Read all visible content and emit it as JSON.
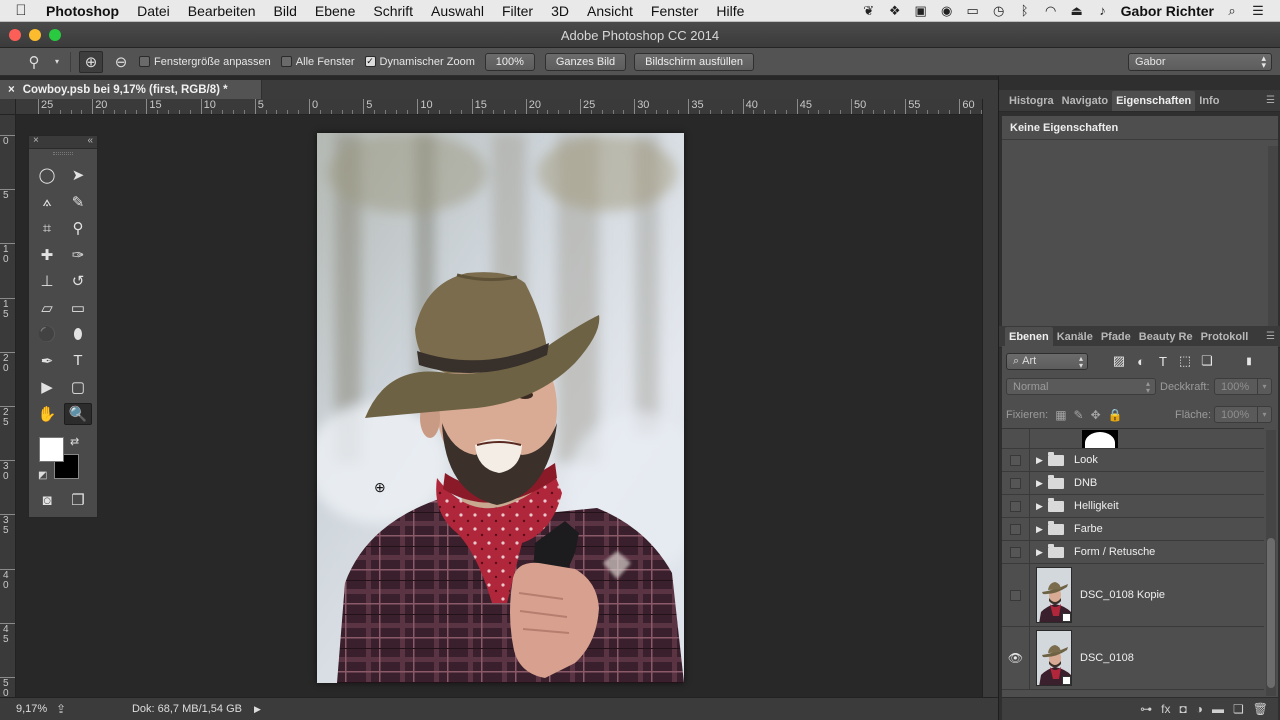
{
  "menubar": {
    "app": "Photoshop",
    "menus": [
      "Datei",
      "Bearbeiten",
      "Bild",
      "Ebene",
      "Schrift",
      "Auswahl",
      "Filter",
      "3D",
      "Ansicht",
      "Fenster",
      "Hilfe"
    ],
    "tray_icons": [
      "evernote-icon",
      "dropbox-icon",
      "app-icon",
      "chrome-icon",
      "airplay-icon",
      "time-machine-icon",
      "bluetooth-icon",
      "wifi-icon",
      "eject-icon",
      "volume-icon"
    ],
    "user": "Gabor Richter",
    "tray_right_icons": [
      "spotlight-icon",
      "notification-center-icon"
    ]
  },
  "window": {
    "title": "Adobe Photoshop CC 2014",
    "lights": [
      "#fc5f57",
      "#fdbc2e",
      "#29c940"
    ]
  },
  "options": {
    "checks": [
      {
        "label": "Fenstergröße anpassen",
        "checked": false
      },
      {
        "label": "Alle Fenster",
        "checked": false
      },
      {
        "label": "Dynamischer Zoom",
        "checked": true
      }
    ],
    "zoom_btn": "100%",
    "fit_btn": "Ganzes Bild",
    "fill_btn": "Bildschirm ausfüllen",
    "workspace": "Gabor"
  },
  "document": {
    "tab": "Cowboy.psb bei 9,17% (first, RGB/8) *",
    "close": "×"
  },
  "ruler": {
    "h_labels": [
      "25",
      "20",
      "15",
      "10",
      "5",
      "0",
      "5",
      "10",
      "15",
      "20",
      "25",
      "30",
      "35",
      "40",
      "45",
      "50",
      "55",
      "60"
    ],
    "v_labels": [
      "0",
      "5",
      "10",
      "15",
      "20",
      "25",
      "30",
      "35",
      "40",
      "45",
      "50"
    ]
  },
  "tools_panel": {
    "close": "×",
    "collapse": "«",
    "tools": [
      {
        "name": "elliptical-marquee-tool",
        "glyph": "◯"
      },
      {
        "name": "move-tool",
        "glyph": "➤"
      },
      {
        "name": "polygonal-lasso-tool",
        "glyph": "⟑"
      },
      {
        "name": "quick-selection-tool",
        "glyph": "✎"
      },
      {
        "name": "crop-tool",
        "glyph": "⌗"
      },
      {
        "name": "eyedropper-tool",
        "glyph": "⚲"
      },
      {
        "name": "healing-brush-tool",
        "glyph": "✚"
      },
      {
        "name": "brush-tool",
        "glyph": "✑"
      },
      {
        "name": "clone-stamp-tool",
        "glyph": "⊥"
      },
      {
        "name": "history-brush-tool",
        "glyph": "↺"
      },
      {
        "name": "eraser-tool",
        "glyph": "▱"
      },
      {
        "name": "gradient-tool",
        "glyph": "▭"
      },
      {
        "name": "dodge-tool",
        "glyph": "⚫"
      },
      {
        "name": "burn-tool",
        "glyph": "⬮"
      },
      {
        "name": "pen-tool",
        "glyph": "✒"
      },
      {
        "name": "type-tool",
        "glyph": "T"
      },
      {
        "name": "path-selection-tool",
        "glyph": "▶"
      },
      {
        "name": "rectangle-tool",
        "glyph": "▢"
      },
      {
        "name": "hand-tool",
        "glyph": "✋"
      },
      {
        "name": "zoom-tool",
        "glyph": "🔍"
      }
    ],
    "foreground_color": "#ffffff",
    "background_color": "#000000"
  },
  "status": {
    "zoom": "9,17%",
    "doc": "Dok: 68,7 MB/1,54 GB"
  },
  "panels_top": {
    "tabs": [
      "Histogra",
      "Navigato",
      "Eigenschaften",
      "Info"
    ],
    "active": "Eigenschaften",
    "content": "Keine Eigenschaften"
  },
  "panels_layers": {
    "tabs": [
      "Ebenen",
      "Kanäle",
      "Pfade",
      "Beauty Re",
      "Protokoll"
    ],
    "active": "Ebenen",
    "filter": "Art",
    "blend_mode": "Normal",
    "opacity_label": "Deckkraft:",
    "opacity": "100%",
    "lock_label": "Fixieren:",
    "fill_label": "Fläche:",
    "fill": "100%",
    "layers": [
      {
        "type": "mask",
        "name": ""
      },
      {
        "type": "group",
        "name": "Look",
        "visible": false
      },
      {
        "type": "group",
        "name": "DNB",
        "visible": false
      },
      {
        "type": "group",
        "name": "Helligkeit",
        "visible": false
      },
      {
        "type": "group",
        "name": "Farbe",
        "visible": false
      },
      {
        "type": "group",
        "name": "Form / Retusche",
        "visible": false
      },
      {
        "type": "smart",
        "name": "DSC_0108 Kopie",
        "visible": false
      },
      {
        "type": "smart",
        "name": "DSC_0108",
        "visible": true
      }
    ]
  }
}
